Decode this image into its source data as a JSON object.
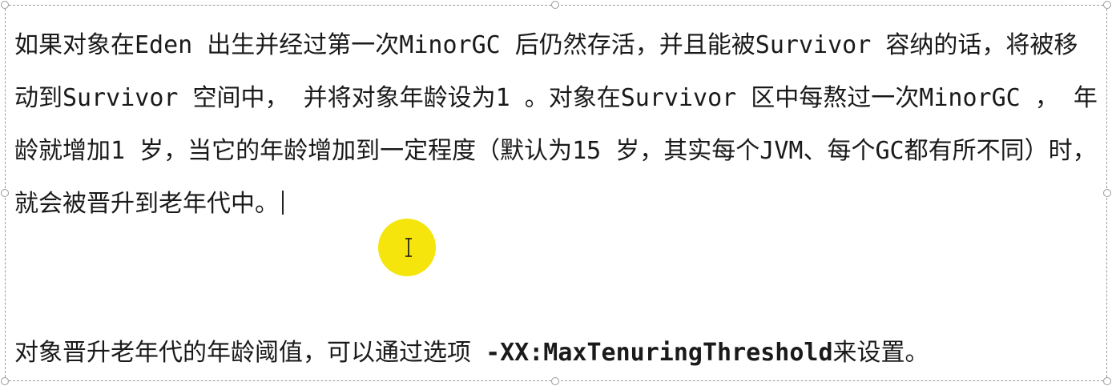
{
  "document": {
    "paragraph1": "如果对象在Eden 出生并经过第一次MinorGC 后仍然存活，并且能被Survivor 容纳的话，将被移动到Survivor 空间中， 并将对象年龄设为1 。对象在Survivor 区中每熬过一次MinorGC ， 年龄就增加1 岁，当它的年龄增加到一定程度（默认为15 岁，其实每个JVM、每个GC都有所不同）时，就会被晋升到老年代中。",
    "paragraph2_prefix": "对象晋升老年代的年龄阈值，可以通过选项 ",
    "paragraph2_option": "-XX:MaxTenuringThreshold",
    "paragraph2_suffix": "来设置。"
  },
  "colors": {
    "cursor_highlight": "#f4e400",
    "text": "#1a1a1a",
    "border": "#9a9a9a"
  },
  "icons": {
    "mouse_cursor": "text-ibeam-icon"
  }
}
